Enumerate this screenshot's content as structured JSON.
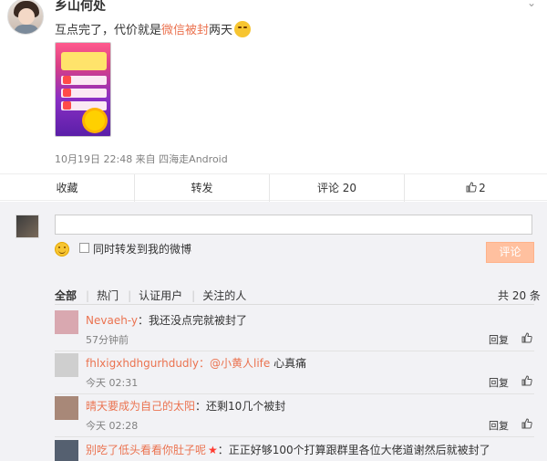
{
  "post": {
    "username": "乡山何处",
    "text_before": "互点完了，代价就是",
    "text_highlight": "微信被封",
    "text_after": "两天",
    "meta": "10月19日 22:48 来自 四海走Android"
  },
  "actions": {
    "collect": "收藏",
    "repost": "转发",
    "comment": "评论 20",
    "like_count": "2"
  },
  "composer": {
    "repost_label": "同时转发到我的微博",
    "submit": "评论"
  },
  "tabs": {
    "all": "全部",
    "hot": "热门",
    "verified": "认证用户",
    "following": "关注的人",
    "total": "共 20 条"
  },
  "comments": [
    {
      "name": "Nevaeh-y",
      "text": "：我还没点完就被封了",
      "time": "57分钟前",
      "reply": "回复",
      "avatar_color": "#d9a8b0"
    },
    {
      "name": "fhlxigxhdhgurhdudly",
      "mention": "：@小黄人life",
      "text": " 心真痛",
      "time": "今天 02:31",
      "reply": "回复",
      "avatar_color": "#cfcfcf"
    },
    {
      "name": "晴天要成为自己的太阳",
      "text": "：还剩10几个被封",
      "time": "今天 02:28",
      "reply": "回复",
      "avatar_color": "#a88878"
    },
    {
      "name": "别吃了低头看看你肚子呢",
      "text": "：正正好够100个打算跟群里各位大佬道谢然后就被封了",
      "time": "",
      "reply": "",
      "avatar_color": "#556070"
    }
  ]
}
